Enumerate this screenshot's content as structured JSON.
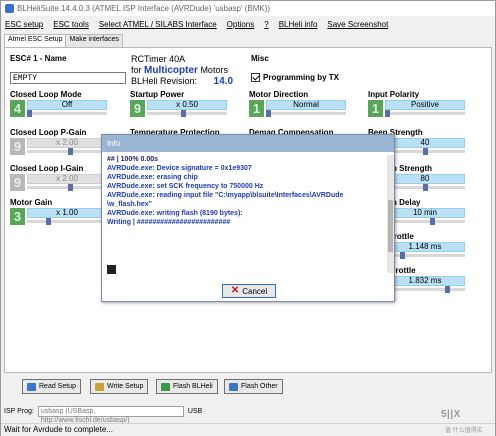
{
  "window": {
    "title": "BLHeliSuite 14.4.0.3  (ATMEL ISP Interface (AVRDude) 'usbasp' (BMK))"
  },
  "menu": [
    "ESC setup",
    "ESC tools",
    "Select ATMEL / SILABS Interface",
    "Options",
    "?",
    "BLHeli info",
    "Save Screenshot"
  ],
  "tabs": [
    "Atmel ESC Setup",
    "Make interfaces"
  ],
  "esc": {
    "label": "ESC# 1 - Name",
    "name": "EMPTY"
  },
  "rc": {
    "title": "RCTimer 40A",
    "for": "for",
    "motor_type": "Multicopter",
    "motors": "Motors",
    "rev_label": "BLHeli Revision:",
    "rev": "14.0"
  },
  "misc": {
    "label": "Misc",
    "checkbox_label": "Programming by TX",
    "checked": true
  },
  "params": [
    {
      "label": "Closed Loop Mode",
      "num": "4",
      "value": "Off",
      "active": true,
      "level": 0.0
    },
    {
      "label": "Startup Power",
      "num": "9",
      "value": "x 0.50",
      "active": true,
      "level": 0.45
    },
    {
      "label": "Motor Direction",
      "num": "1",
      "value": "Normal",
      "active": true,
      "level": 0.0
    },
    {
      "label": "Input Polarity",
      "num": "1",
      "value": "Positive",
      "active": true,
      "level": 0.0
    },
    {
      "label": "Closed Loop P-Gain",
      "num": "9",
      "value": "x 2.00",
      "active": false,
      "level": 0.55
    },
    {
      "label": "Temperature Protection",
      "num": "",
      "value": "",
      "active": false,
      "level": 0.0
    },
    {
      "label": "Demag Compensation",
      "num": "",
      "value": "",
      "active": false,
      "level": 0.0
    },
    {
      "label": "Beep Strength",
      "num": "",
      "value": "40",
      "active": true,
      "level": 0.5
    },
    {
      "label": "Closed Loop I-Gain",
      "num": "9",
      "value": "x 2.00",
      "active": false,
      "level": 0.55
    },
    {
      "label": "Beacon Strength",
      "num": "",
      "value": "80",
      "active": true,
      "level": 0.5
    },
    {
      "label": "Motor Gain",
      "num": "3",
      "value": "x 1.00",
      "active": true,
      "level": 0.25
    },
    {
      "label": "Beacon Delay",
      "num": "",
      "value": "10 min",
      "active": true,
      "level": 0.6
    },
    {
      "label": "Min Throttle",
      "num": "",
      "value": "1.148 ms",
      "active": true,
      "level": 0.2
    },
    {
      "label": "Max Throttle",
      "num": "",
      "value": "1.832 ms",
      "active": true,
      "level": 0.8
    }
  ],
  "dialog": {
    "title": "Info",
    "log": [
      "## | 100% 0.00s",
      "",
      "AVRDude.exe: Device signature = 0x1e9307",
      "AVRDude.exe: erasing chip",
      "AVRDude.exe: set SCK frequency to 750000 Hz",
      "AVRDude.exe: reading input file \"C:\\myapp\\blsuite\\Interfaces\\AVRDude",
      "\\w_flash.hex\"",
      "AVRDude.exe: writing flash (8190 bytes):",
      "",
      "Writing | ########################"
    ],
    "cancel_label": "Cancel"
  },
  "buttons": {
    "read": "Read Setup",
    "write": "Write Setup",
    "flash": "Flash BLHeli",
    "flash_other": "Flash Other"
  },
  "isp": {
    "label": "ISP Prog:",
    "value": "usbasp (USBasp, http://www.fischl.de/usbasp/)",
    "port": "USB"
  },
  "status": "Wait for Avrdude to complete...",
  "watermark": {
    "logo": "5||X",
    "text": "值 什么值得买"
  },
  "colors": {
    "accent": "#1a3fb5",
    "slider": "#b9e0f5",
    "num_green": "#5aa55a",
    "cancel_icon": "#c8161e"
  }
}
